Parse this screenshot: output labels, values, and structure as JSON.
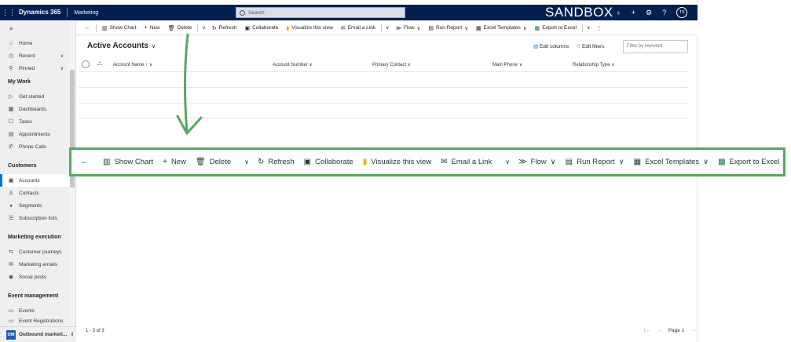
{
  "topbar": {
    "app_name": "Dynamics 365",
    "area_name": "Marketing",
    "search_placeholder": "Search",
    "environment_label": "SANDBOX",
    "user_initials": "TS"
  },
  "sidebar": {
    "items_top": [
      {
        "label": "Home",
        "icon": "home-icon"
      },
      {
        "label": "Recent",
        "icon": "clock-icon"
      },
      {
        "label": "Pinned",
        "icon": "pin-icon"
      }
    ],
    "sections": [
      {
        "title": "My Work",
        "items": [
          "Get started",
          "Dashboards",
          "Tasks",
          "Appointments",
          "Phone Calls"
        ]
      },
      {
        "title": "Customers",
        "items": [
          "Accounts",
          "Contacts",
          "Segments",
          "Subscription lists"
        ]
      },
      {
        "title": "Marketing execution",
        "items": [
          "Customer journeys",
          "Marketing emails",
          "Social posts"
        ]
      },
      {
        "title": "Event management",
        "items": [
          "Events",
          "Event Registrations"
        ]
      }
    ],
    "active_item": "Accounts",
    "footer": {
      "badge": "OM",
      "label": "Outbound marketi..."
    }
  },
  "commands": [
    {
      "label": "Show Chart",
      "icon": "chart-icon"
    },
    {
      "label": "New",
      "icon": "plus-icon"
    },
    {
      "label": "Delete",
      "icon": "trash-icon"
    },
    {
      "label": "Refresh",
      "icon": "refresh-icon"
    },
    {
      "label": "Collaborate",
      "icon": "teams-icon"
    },
    {
      "label": "Visualize this view",
      "icon": "powerbi-icon"
    },
    {
      "label": "Email a Link",
      "icon": "email-icon"
    },
    {
      "label": "Flow",
      "icon": "flow-icon"
    },
    {
      "label": "Run Report",
      "icon": "report-icon"
    },
    {
      "label": "Excel Templates",
      "icon": "excel-template-icon"
    },
    {
      "label": "Export to Excel",
      "icon": "excel-icon"
    }
  ],
  "view": {
    "title": "Active Accounts",
    "edit_columns": "Edit columns",
    "edit_filters": "Edit filters",
    "filter_placeholder": "Filter by keyword",
    "columns": [
      "Account Name ↑",
      "Account Number",
      "Primary Contact",
      "Main Phone",
      "Relationship Type"
    ],
    "record_count": "1 - 3 of 3",
    "page_label": "Page 1"
  },
  "colors": {
    "nav": "#002050",
    "accent": "#0078d4",
    "callout": "#57a85f"
  }
}
